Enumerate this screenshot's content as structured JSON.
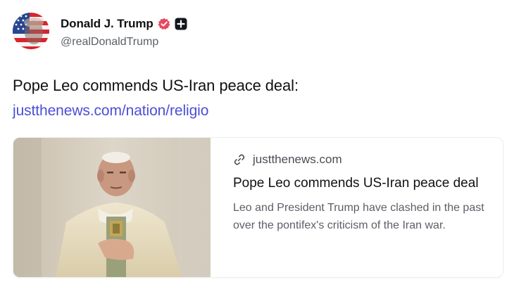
{
  "author": {
    "display_name": "Donald J. Trump",
    "handle": "@realDonaldTrump",
    "avatar_icon": "flag-portrait-avatar",
    "verified_icon": "verified-badge-icon",
    "badge_icon": "plus-badge-icon",
    "verified_color": "#e84860"
  },
  "post": {
    "text": "Pope Leo commends US-Iran peace deal:",
    "link_text": "justthenews.com/nation/religio",
    "link_color": "#4a4fd8"
  },
  "link_card": {
    "link_icon": "link-icon",
    "domain": "justthenews.com",
    "title": "Pope Leo commends US-Iran peace deal",
    "description": "Leo and President Trump have clashed in the past over the pontifex's criticism of the Iran war.",
    "image_icon": "pope-photo-thumbnail"
  }
}
